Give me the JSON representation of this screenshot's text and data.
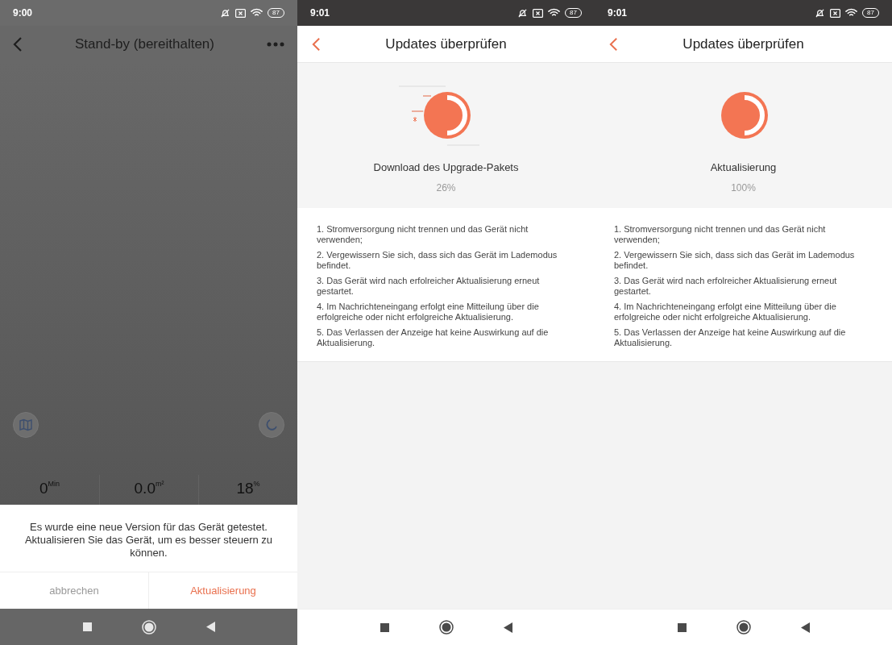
{
  "screens": [
    {
      "kind": "device",
      "status_bar": {
        "time": "9:00",
        "battery": "87"
      },
      "title": "Stand-by (bereithalten)",
      "stats": [
        {
          "value": "0",
          "unit": "Min"
        },
        {
          "value": "0.0",
          "unit": "m²"
        },
        {
          "value": "18",
          "unit": "%"
        }
      ],
      "dialog": {
        "message": "Es wurde eine neue Version für das Gerät getestet. Aktualisieren Sie das Gerät, um es besser steuern zu können.",
        "buttons": [
          {
            "label": "abbrechen",
            "kind": "cancel"
          },
          {
            "label": "Aktualisierung",
            "kind": "confirm"
          }
        ]
      }
    },
    {
      "kind": "update",
      "animating": true,
      "status_bar": {
        "time": "9:01",
        "battery": "87"
      },
      "title": "Updates überprüfen",
      "caption": "Download des Upgrade-Pakets",
      "percent": "26%",
      "notes": [
        "1. Stromversorgung nicht trennen und das Gerät nicht verwenden;",
        "2. Vergewissern Sie sich, dass sich das Gerät im Lademodus befindet.",
        "3. Das Gerät wird nach erfolreicher Aktualisierung erneut gestartet.",
        "4. Im Nachrichteneingang erfolgt eine Mitteilung über die erfolgreiche oder nicht erfolgreiche Aktualisierung.",
        "5. Das Verlassen der Anzeige hat keine Auswirkung auf die Aktualisierung."
      ]
    },
    {
      "kind": "update",
      "animating": false,
      "status_bar": {
        "time": "9:01",
        "battery": "87"
      },
      "title": "Updates überprüfen",
      "caption": "Aktualisierung",
      "percent": "100%",
      "notes": [
        "1. Stromversorgung nicht trennen und das Gerät nicht verwenden;",
        "2. Vergewissern Sie sich, dass sich das Gerät im Lademodus befindet.",
        "3. Das Gerät wird nach erfolreicher Aktualisierung erneut gestartet.",
        "4. Im Nachrichteneingang erfolgt eine Mitteilung über die erfolgreiche oder nicht erfolgreiche Aktualisierung.",
        "5. Das Verlassen der Anzeige hat keine Auswirkung auf die Aktualisierung."
      ]
    }
  ]
}
